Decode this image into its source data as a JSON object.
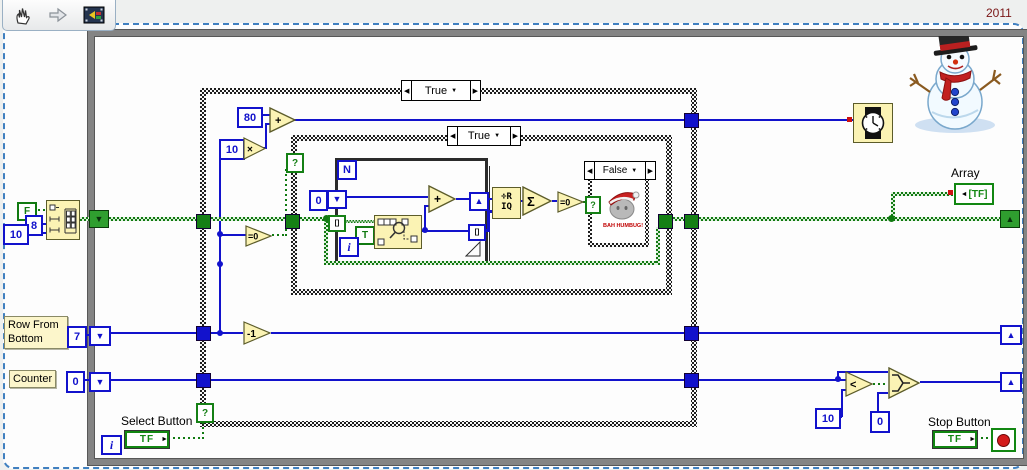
{
  "year": "2011",
  "glyphs": {
    "prev": "◀",
    "next": "▶",
    "drop": "▼",
    "up": "▲",
    "down": "▼",
    "q": "?",
    "idx": "[]",
    "term_arrow": "►",
    "ind_arrow": "◄"
  },
  "cases": {
    "outer": "True",
    "inner": "True",
    "nested": "False"
  },
  "loops": {
    "for_count": "N",
    "for_iter": "i",
    "while_iter": "i"
  },
  "consts": {
    "init_bool": "F",
    "init_cols": "8",
    "init_rows": "10",
    "delay_base": "80",
    "delay_scale": "10",
    "row_start": "7",
    "counter_start": "0",
    "for_init": "0",
    "search_target": "T",
    "limit": "10",
    "reset": "0"
  },
  "nodes": {
    "add": "+",
    "multiply": "×",
    "row_is_zero": "=0",
    "decrement": "-1",
    "add_index": "+",
    "quotient_top": "÷R",
    "quotient_bot": "IQ",
    "sum": "Σ",
    "sum_is_zero": "=0",
    "less": "<"
  },
  "controls": {
    "row_label": "Row From Bottom",
    "counter_label": "Counter",
    "select_label": "Select Button",
    "select_value": "TF",
    "stop_label": "Stop Button",
    "stop_value": "TF"
  },
  "indicators": {
    "array_label": "Array",
    "array_value": "[TF]"
  },
  "clipart": {
    "humbug": "BAH HUMBUG!"
  }
}
